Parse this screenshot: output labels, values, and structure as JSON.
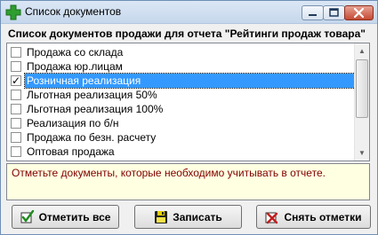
{
  "window": {
    "title": "Список документов",
    "controls": {
      "minimize": "—",
      "maximize": "□",
      "close": "✕"
    }
  },
  "subtitle": "Список документов продажи для отчета \"Рейтинги продаж товара\"",
  "list": {
    "items": [
      {
        "label": "Продажа со склада",
        "checked": false,
        "selected": false
      },
      {
        "label": "Продажа юр.лицам",
        "checked": false,
        "selected": false
      },
      {
        "label": "Розничная реализация",
        "checked": true,
        "selected": true
      },
      {
        "label": "Льготная реализация 50%",
        "checked": false,
        "selected": false
      },
      {
        "label": "Льготная реализация 100%",
        "checked": false,
        "selected": false
      },
      {
        "label": "Реализация по б/н",
        "checked": false,
        "selected": false
      },
      {
        "label": "Продажа по безн. расчету",
        "checked": false,
        "selected": false
      },
      {
        "label": "Оптовая продажа",
        "checked": false,
        "selected": false
      }
    ],
    "scrollbar": {
      "up": "▲",
      "down": "▼"
    }
  },
  "hint": "Отметьте документы, которые необходимо учитывать в отчете.",
  "buttons": {
    "check_all": "Отметить все",
    "save": "Записать",
    "clear_marks": "Снять отметки"
  },
  "colors": {
    "selection": "#3399ff",
    "hint_background": "#ffffe1",
    "hint_text": "#800000",
    "app_icon": "#2e9e2e"
  }
}
